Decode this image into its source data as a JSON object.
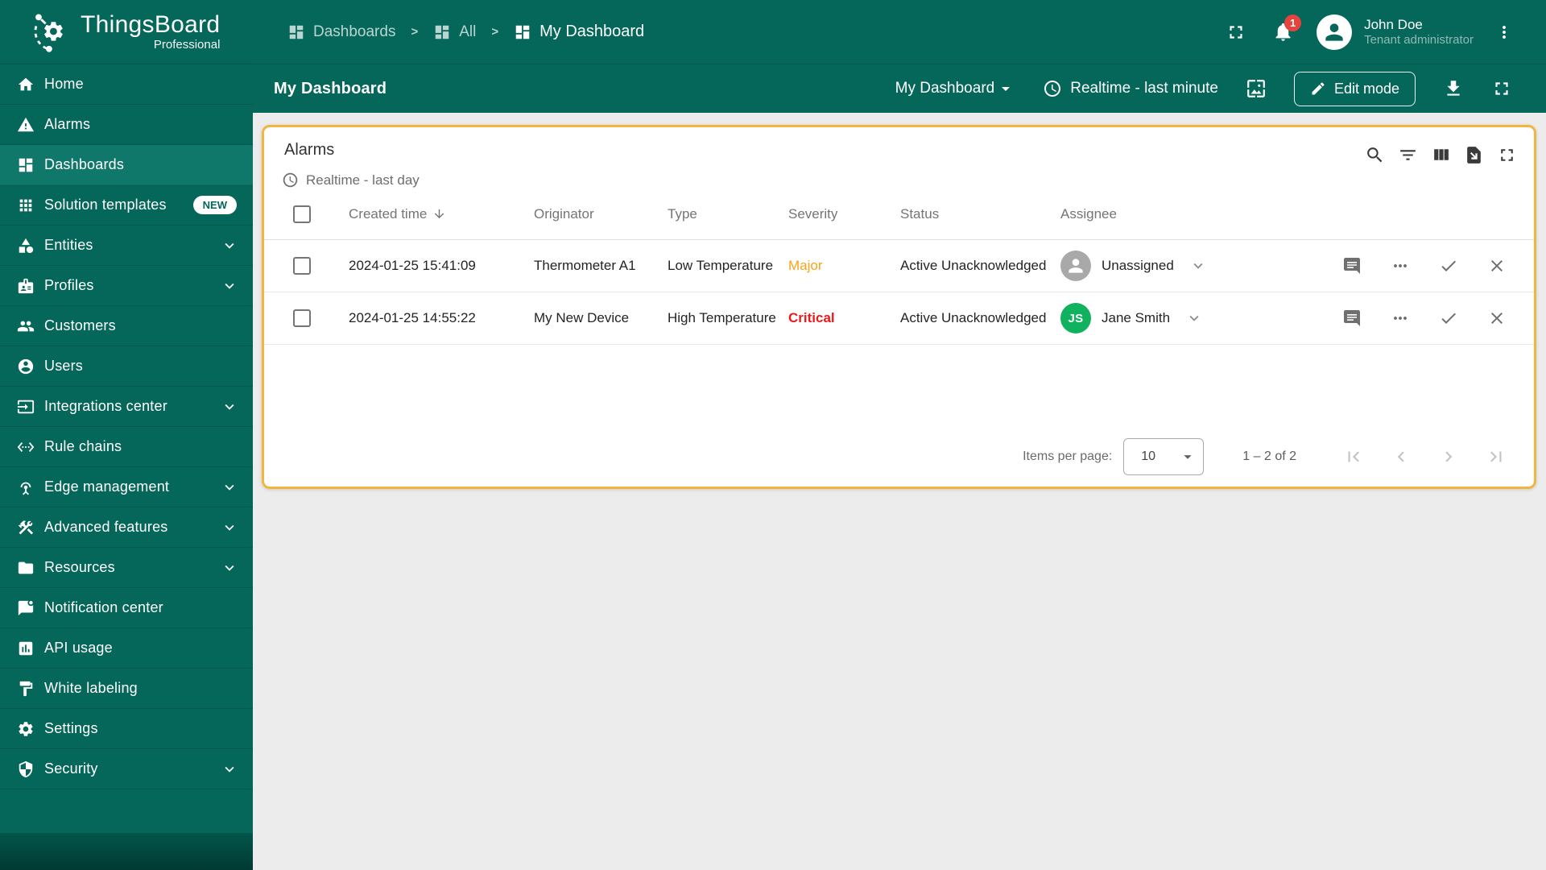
{
  "app": {
    "name": "ThingsBoard",
    "edition": "Professional"
  },
  "sidebar": {
    "items": [
      {
        "label": "Home"
      },
      {
        "label": "Alarms"
      },
      {
        "label": "Dashboards"
      },
      {
        "label": "Solution templates",
        "badge": "NEW"
      },
      {
        "label": "Entities"
      },
      {
        "label": "Profiles"
      },
      {
        "label": "Customers"
      },
      {
        "label": "Users"
      },
      {
        "label": "Integrations center"
      },
      {
        "label": "Rule chains"
      },
      {
        "label": "Edge management"
      },
      {
        "label": "Advanced features"
      },
      {
        "label": "Resources"
      },
      {
        "label": "Notification center"
      },
      {
        "label": "API usage"
      },
      {
        "label": "White labeling"
      },
      {
        "label": "Settings"
      },
      {
        "label": "Security"
      }
    ]
  },
  "topbar": {
    "breadcrumb": [
      {
        "label": "Dashboards"
      },
      {
        "label": "All"
      },
      {
        "label": "My Dashboard"
      }
    ],
    "separator": ">",
    "notification_count": "1",
    "user": {
      "name": "John Doe",
      "role": "Tenant administrator"
    }
  },
  "toolbar": {
    "title": "My Dashboard",
    "state_selector": "My Dashboard",
    "timewindow": "Realtime - last minute",
    "edit_button": "Edit mode"
  },
  "widget": {
    "title": "Alarms",
    "timewindow": "Realtime - last day",
    "columns": {
      "created_time": "Created time",
      "originator": "Originator",
      "type": "Type",
      "severity": "Severity",
      "status": "Status",
      "assignee": "Assignee"
    },
    "rows": [
      {
        "created_time": "2024-01-25 15:41:09",
        "originator": "Thermometer A1",
        "type": "Low Temperature",
        "severity": "Major",
        "status": "Active Unacknowledged",
        "assignee": "Unassigned"
      },
      {
        "created_time": "2024-01-25 14:55:22",
        "originator": "My New Device",
        "type": "High Temperature",
        "severity": "Critical",
        "status": "Active Unacknowledged",
        "assignee": "Jane Smith",
        "assignee_initials": "JS"
      }
    ],
    "paginator": {
      "items_per_page_label": "Items per page:",
      "page_size": "10",
      "range_label": "1 – 2 of 2"
    }
  },
  "colors": {
    "sidebar_teal": "#05665a",
    "active_item_teal": "#10786b",
    "widget_border_orange": "#f2b640",
    "severity_major": "#faa31a",
    "severity_critical": "#ec1a1a",
    "assignee_avatar_green": "#10b25f",
    "notification_badge_red": "#e5433d",
    "page_background": "#ececec"
  }
}
